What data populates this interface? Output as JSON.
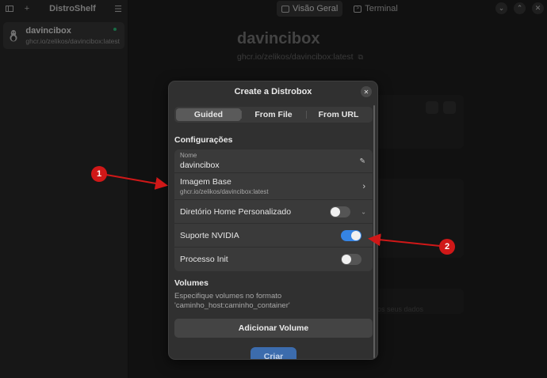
{
  "sidebar": {
    "title": "DistroShelf",
    "add_icon": "plus-icon",
    "menu_icon": "hamburger-icon",
    "items": [
      {
        "name": "davincibox",
        "image": "ghcr.io/zelikos/davincibox:latest",
        "status_color": "#2ec27e"
      }
    ]
  },
  "main": {
    "tabs": [
      {
        "label": "Visão Geral",
        "active": true
      },
      {
        "label": "Terminal",
        "active": false
      }
    ],
    "box_title": "davincibox",
    "box_image": "ghcr.io/zelikos/davincibox:latest",
    "faded_note": "os seus dados"
  },
  "dialog": {
    "title": "Create a Distrobox",
    "modes": [
      "Guided",
      "From File",
      "From URL"
    ],
    "active_mode": "Guided",
    "config_heading": "Configurações",
    "name_label": "Nome",
    "name_value": "davincibox",
    "base_image_label": "Imagem Base",
    "base_image_value": "ghcr.io/zelikos/davincibox:latest",
    "home_dir_label": "Diretório Home Personalizado",
    "home_dir_enabled": false,
    "nvidia_label": "Suporte NVIDIA",
    "nvidia_enabled": true,
    "init_label": "Processo Init",
    "init_enabled": false,
    "volumes_heading": "Volumes",
    "volumes_desc": "Especifique volumes no formato 'caminho_host:caminho_container'",
    "add_volume_label": "Adicionar Volume",
    "create_label": "Criar"
  },
  "annotations": [
    {
      "number": "1",
      "color": "#d01818"
    },
    {
      "number": "2",
      "color": "#d01818"
    }
  ],
  "colors": {
    "accent": "#3584e4",
    "annotation": "#d01818"
  }
}
